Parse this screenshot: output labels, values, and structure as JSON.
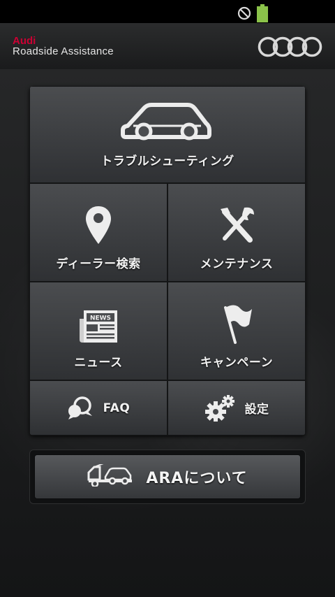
{
  "header": {
    "brand": "Audi",
    "subtitle": "Roadside Assistance"
  },
  "menu": {
    "troubleshooting": "トラブルシューティング",
    "dealer_search": "ディーラー検索",
    "maintenance": "メンテナンス",
    "news": "ニュース",
    "campaign": "キャンペーン",
    "faq": "FAQ",
    "settings": "設定"
  },
  "news_icon_text": "NEWS",
  "about_button": "ARAについて",
  "colors": {
    "brand_red": "#cc0033",
    "battery_green": "#8bc34a"
  }
}
